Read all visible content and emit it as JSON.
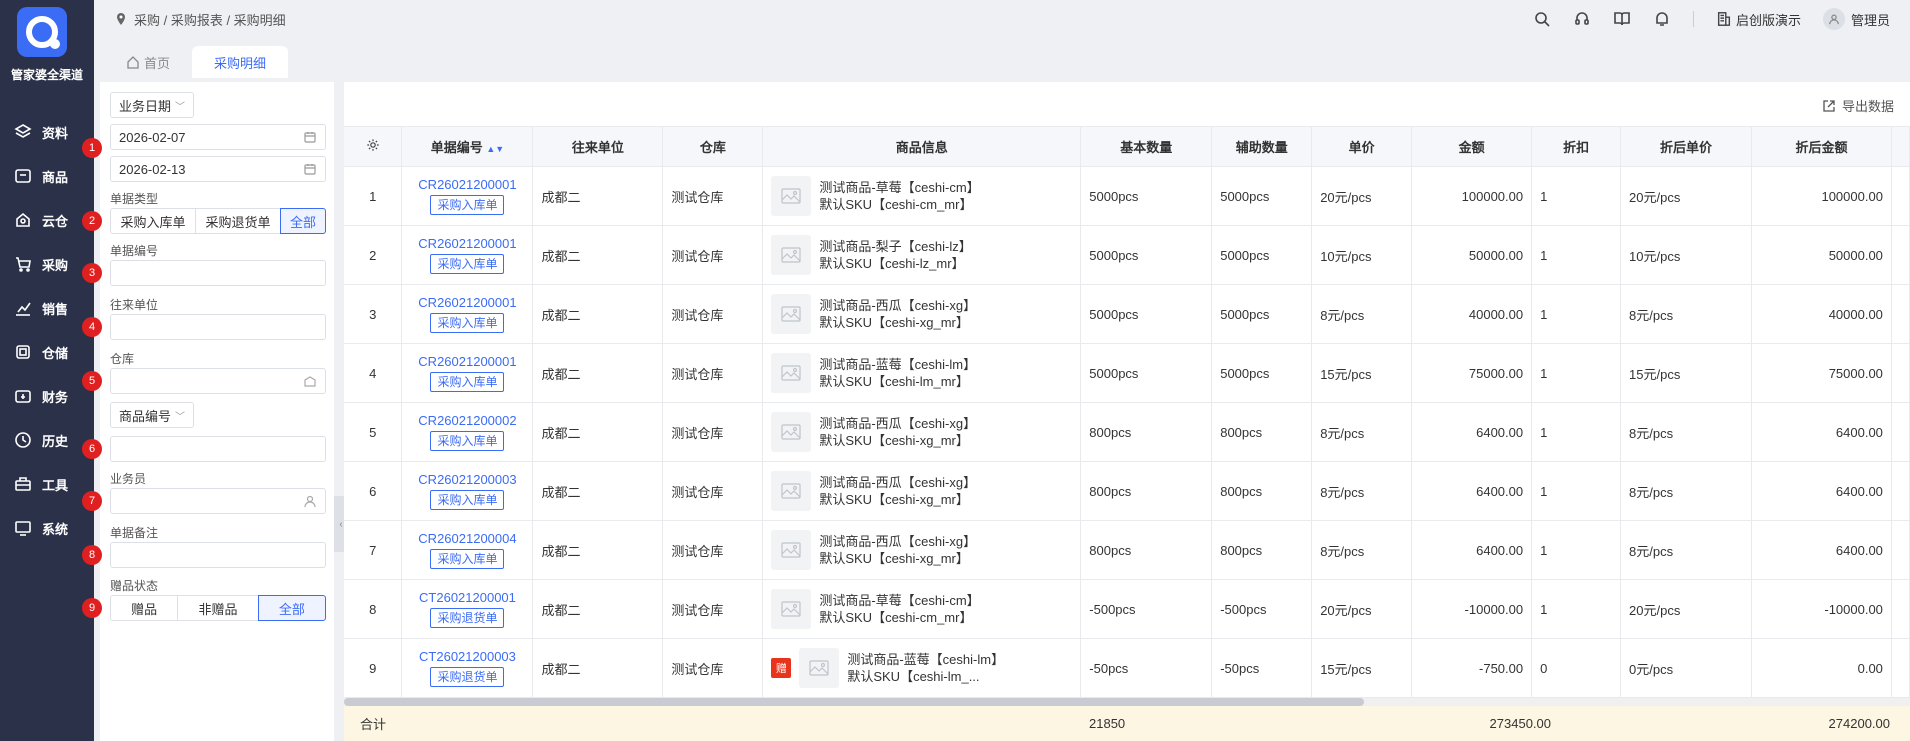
{
  "brand": {
    "name": "管家婆全渠道"
  },
  "nav": [
    {
      "label": "资料",
      "icon": "layers-icon"
    },
    {
      "label": "商品",
      "icon": "box-icon"
    },
    {
      "label": "云仓",
      "icon": "cloud-icon"
    },
    {
      "label": "采购",
      "icon": "cart-icon"
    },
    {
      "label": "销售",
      "icon": "chart-icon"
    },
    {
      "label": "仓储",
      "icon": "warehouse-icon"
    },
    {
      "label": "财务",
      "icon": "wallet-icon"
    },
    {
      "label": "历史",
      "icon": "clock-icon"
    },
    {
      "label": "工具",
      "icon": "toolbox-icon"
    },
    {
      "label": "系统",
      "icon": "monitor-icon"
    }
  ],
  "breadcrumb": "采购 / 采购报表 / 采购明细",
  "header": {
    "store": "启创版演示",
    "user": "管理员"
  },
  "tabs": [
    {
      "label": "首页"
    },
    {
      "label": "采购明细"
    }
  ],
  "filter": {
    "date_type": "业务日期",
    "date_start": "2026-02-07",
    "date_end": "2026-02-13",
    "doc_type_label": "单据类型",
    "doc_type_options": [
      "采购入库单",
      "采购退货单",
      "全部"
    ],
    "doc_no_label": "单据编号",
    "partner_label": "往来单位",
    "warehouse_label": "仓库",
    "product_key": "商品编号",
    "staff_label": "业务员",
    "remark_label": "单据备注",
    "gift_label": "赠品状态",
    "gift_options": [
      "赠品",
      "非赠品",
      "全部"
    ],
    "badges": [
      "1",
      "2",
      "3",
      "4",
      "5",
      "6",
      "7",
      "8",
      "9"
    ]
  },
  "export_label": "导出数据",
  "columns": [
    "单据编号",
    "往来单位",
    "仓库",
    "商品信息",
    "基本数量",
    "辅助数量",
    "单价",
    "金额",
    "折扣",
    "折后单价",
    "折后金额"
  ],
  "rows": [
    {
      "idx": "1",
      "doc": "CR26021200001",
      "type": "采购入库单",
      "partner": "成都二",
      "wh": "测试仓库",
      "p1": "测试商品-草莓【ceshi-cm】",
      "p2": "默认SKU【ceshi-cm_mr】",
      "gift": "",
      "qty": "5000pcs",
      "aux": "5000pcs",
      "price": "20元/pcs",
      "amt": "100000.00",
      "disc": "1",
      "dprice": "20元/pcs",
      "damt": "100000.00"
    },
    {
      "idx": "2",
      "doc": "CR26021200001",
      "type": "采购入库单",
      "partner": "成都二",
      "wh": "测试仓库",
      "p1": "测试商品-梨子【ceshi-lz】",
      "p2": "默认SKU【ceshi-lz_mr】",
      "gift": "",
      "qty": "5000pcs",
      "aux": "5000pcs",
      "price": "10元/pcs",
      "amt": "50000.00",
      "disc": "1",
      "dprice": "10元/pcs",
      "damt": "50000.00"
    },
    {
      "idx": "3",
      "doc": "CR26021200001",
      "type": "采购入库单",
      "partner": "成都二",
      "wh": "测试仓库",
      "p1": "测试商品-西瓜【ceshi-xg】",
      "p2": "默认SKU【ceshi-xg_mr】",
      "gift": "",
      "qty": "5000pcs",
      "aux": "5000pcs",
      "price": "8元/pcs",
      "amt": "40000.00",
      "disc": "1",
      "dprice": "8元/pcs",
      "damt": "40000.00"
    },
    {
      "idx": "4",
      "doc": "CR26021200001",
      "type": "采购入库单",
      "partner": "成都二",
      "wh": "测试仓库",
      "p1": "测试商品-蓝莓【ceshi-lm】",
      "p2": "默认SKU【ceshi-lm_mr】",
      "gift": "",
      "qty": "5000pcs",
      "aux": "5000pcs",
      "price": "15元/pcs",
      "amt": "75000.00",
      "disc": "1",
      "dprice": "15元/pcs",
      "damt": "75000.00"
    },
    {
      "idx": "5",
      "doc": "CR26021200002",
      "type": "采购入库单",
      "partner": "成都二",
      "wh": "测试仓库",
      "p1": "测试商品-西瓜【ceshi-xg】",
      "p2": "默认SKU【ceshi-xg_mr】",
      "gift": "",
      "qty": "800pcs",
      "aux": "800pcs",
      "price": "8元/pcs",
      "amt": "6400.00",
      "disc": "1",
      "dprice": "8元/pcs",
      "damt": "6400.00"
    },
    {
      "idx": "6",
      "doc": "CR26021200003",
      "type": "采购入库单",
      "partner": "成都二",
      "wh": "测试仓库",
      "p1": "测试商品-西瓜【ceshi-xg】",
      "p2": "默认SKU【ceshi-xg_mr】",
      "gift": "",
      "qty": "800pcs",
      "aux": "800pcs",
      "price": "8元/pcs",
      "amt": "6400.00",
      "disc": "1",
      "dprice": "8元/pcs",
      "damt": "6400.00"
    },
    {
      "idx": "7",
      "doc": "CR26021200004",
      "type": "采购入库单",
      "partner": "成都二",
      "wh": "测试仓库",
      "p1": "测试商品-西瓜【ceshi-xg】",
      "p2": "默认SKU【ceshi-xg_mr】",
      "gift": "",
      "qty": "800pcs",
      "aux": "800pcs",
      "price": "8元/pcs",
      "amt": "6400.00",
      "disc": "1",
      "dprice": "8元/pcs",
      "damt": "6400.00"
    },
    {
      "idx": "8",
      "doc": "CT26021200001",
      "type": "采购退货单",
      "partner": "成都二",
      "wh": "测试仓库",
      "p1": "测试商品-草莓【ceshi-cm】",
      "p2": "默认SKU【ceshi-cm_mr】",
      "gift": "",
      "qty": "-500pcs",
      "aux": "-500pcs",
      "price": "20元/pcs",
      "amt": "-10000.00",
      "disc": "1",
      "dprice": "20元/pcs",
      "damt": "-10000.00"
    },
    {
      "idx": "9",
      "doc": "CT26021200003",
      "type": "采购退货单",
      "partner": "成都二",
      "wh": "测试仓库",
      "p1": "测试商品-蓝莓【ceshi-lm】",
      "p2": "默认SKU【ceshi-lm_...",
      "gift": "赠",
      "qty": "-50pcs",
      "aux": "-50pcs",
      "price": "15元/pcs",
      "amt": "-750.00",
      "disc": "0",
      "dprice": "0元/pcs",
      "damt": "0.00"
    }
  ],
  "totals": {
    "label": "合计",
    "qty": "21850",
    "amt": "273450.00",
    "damt": "274200.00"
  }
}
